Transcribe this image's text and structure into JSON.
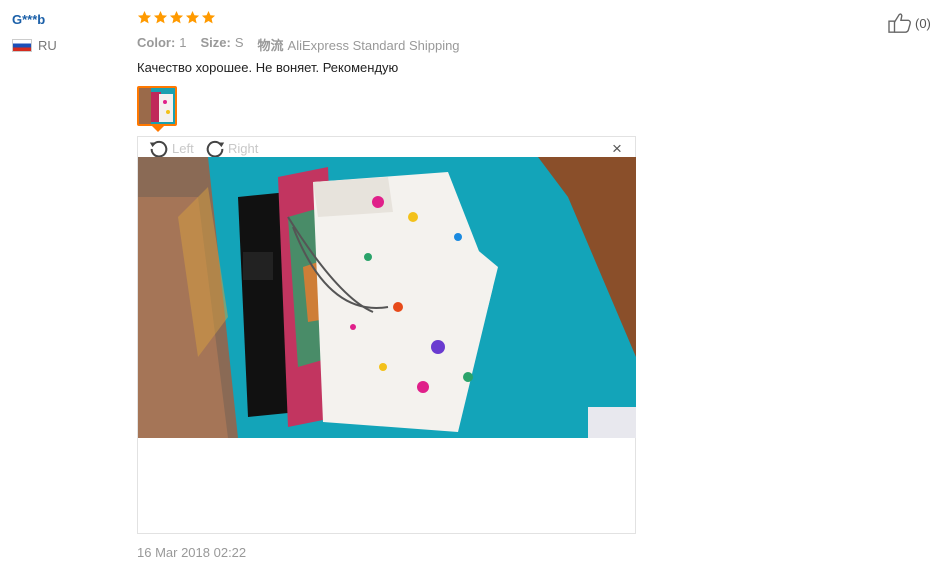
{
  "review": {
    "user_name": "G***b",
    "country": "RU",
    "rating": 5,
    "color_label": "Color:",
    "color_value": "1",
    "size_label": "Size:",
    "size_value": "S",
    "shipping_label": "物流",
    "shipping_value": "AliExpress Standard Shipping",
    "text": "Качество хорошее. Не воняет. Рекомендую",
    "date": "16 Mar 2018 02:22",
    "likes": "(0)"
  },
  "viewer": {
    "rotate_left_label": "Left",
    "rotate_right_label": "Right",
    "close_glyph": "×"
  },
  "colors": {
    "star": "#ff9a00",
    "username": "#1a5fa8",
    "thumb_border": "#ff7800"
  },
  "icons": {
    "rotate_left": "rotate-left-icon",
    "rotate_right": "rotate-right-icon",
    "like": "thumbs-up-icon",
    "close": "close-icon",
    "flag": "flag-ru-icon"
  }
}
